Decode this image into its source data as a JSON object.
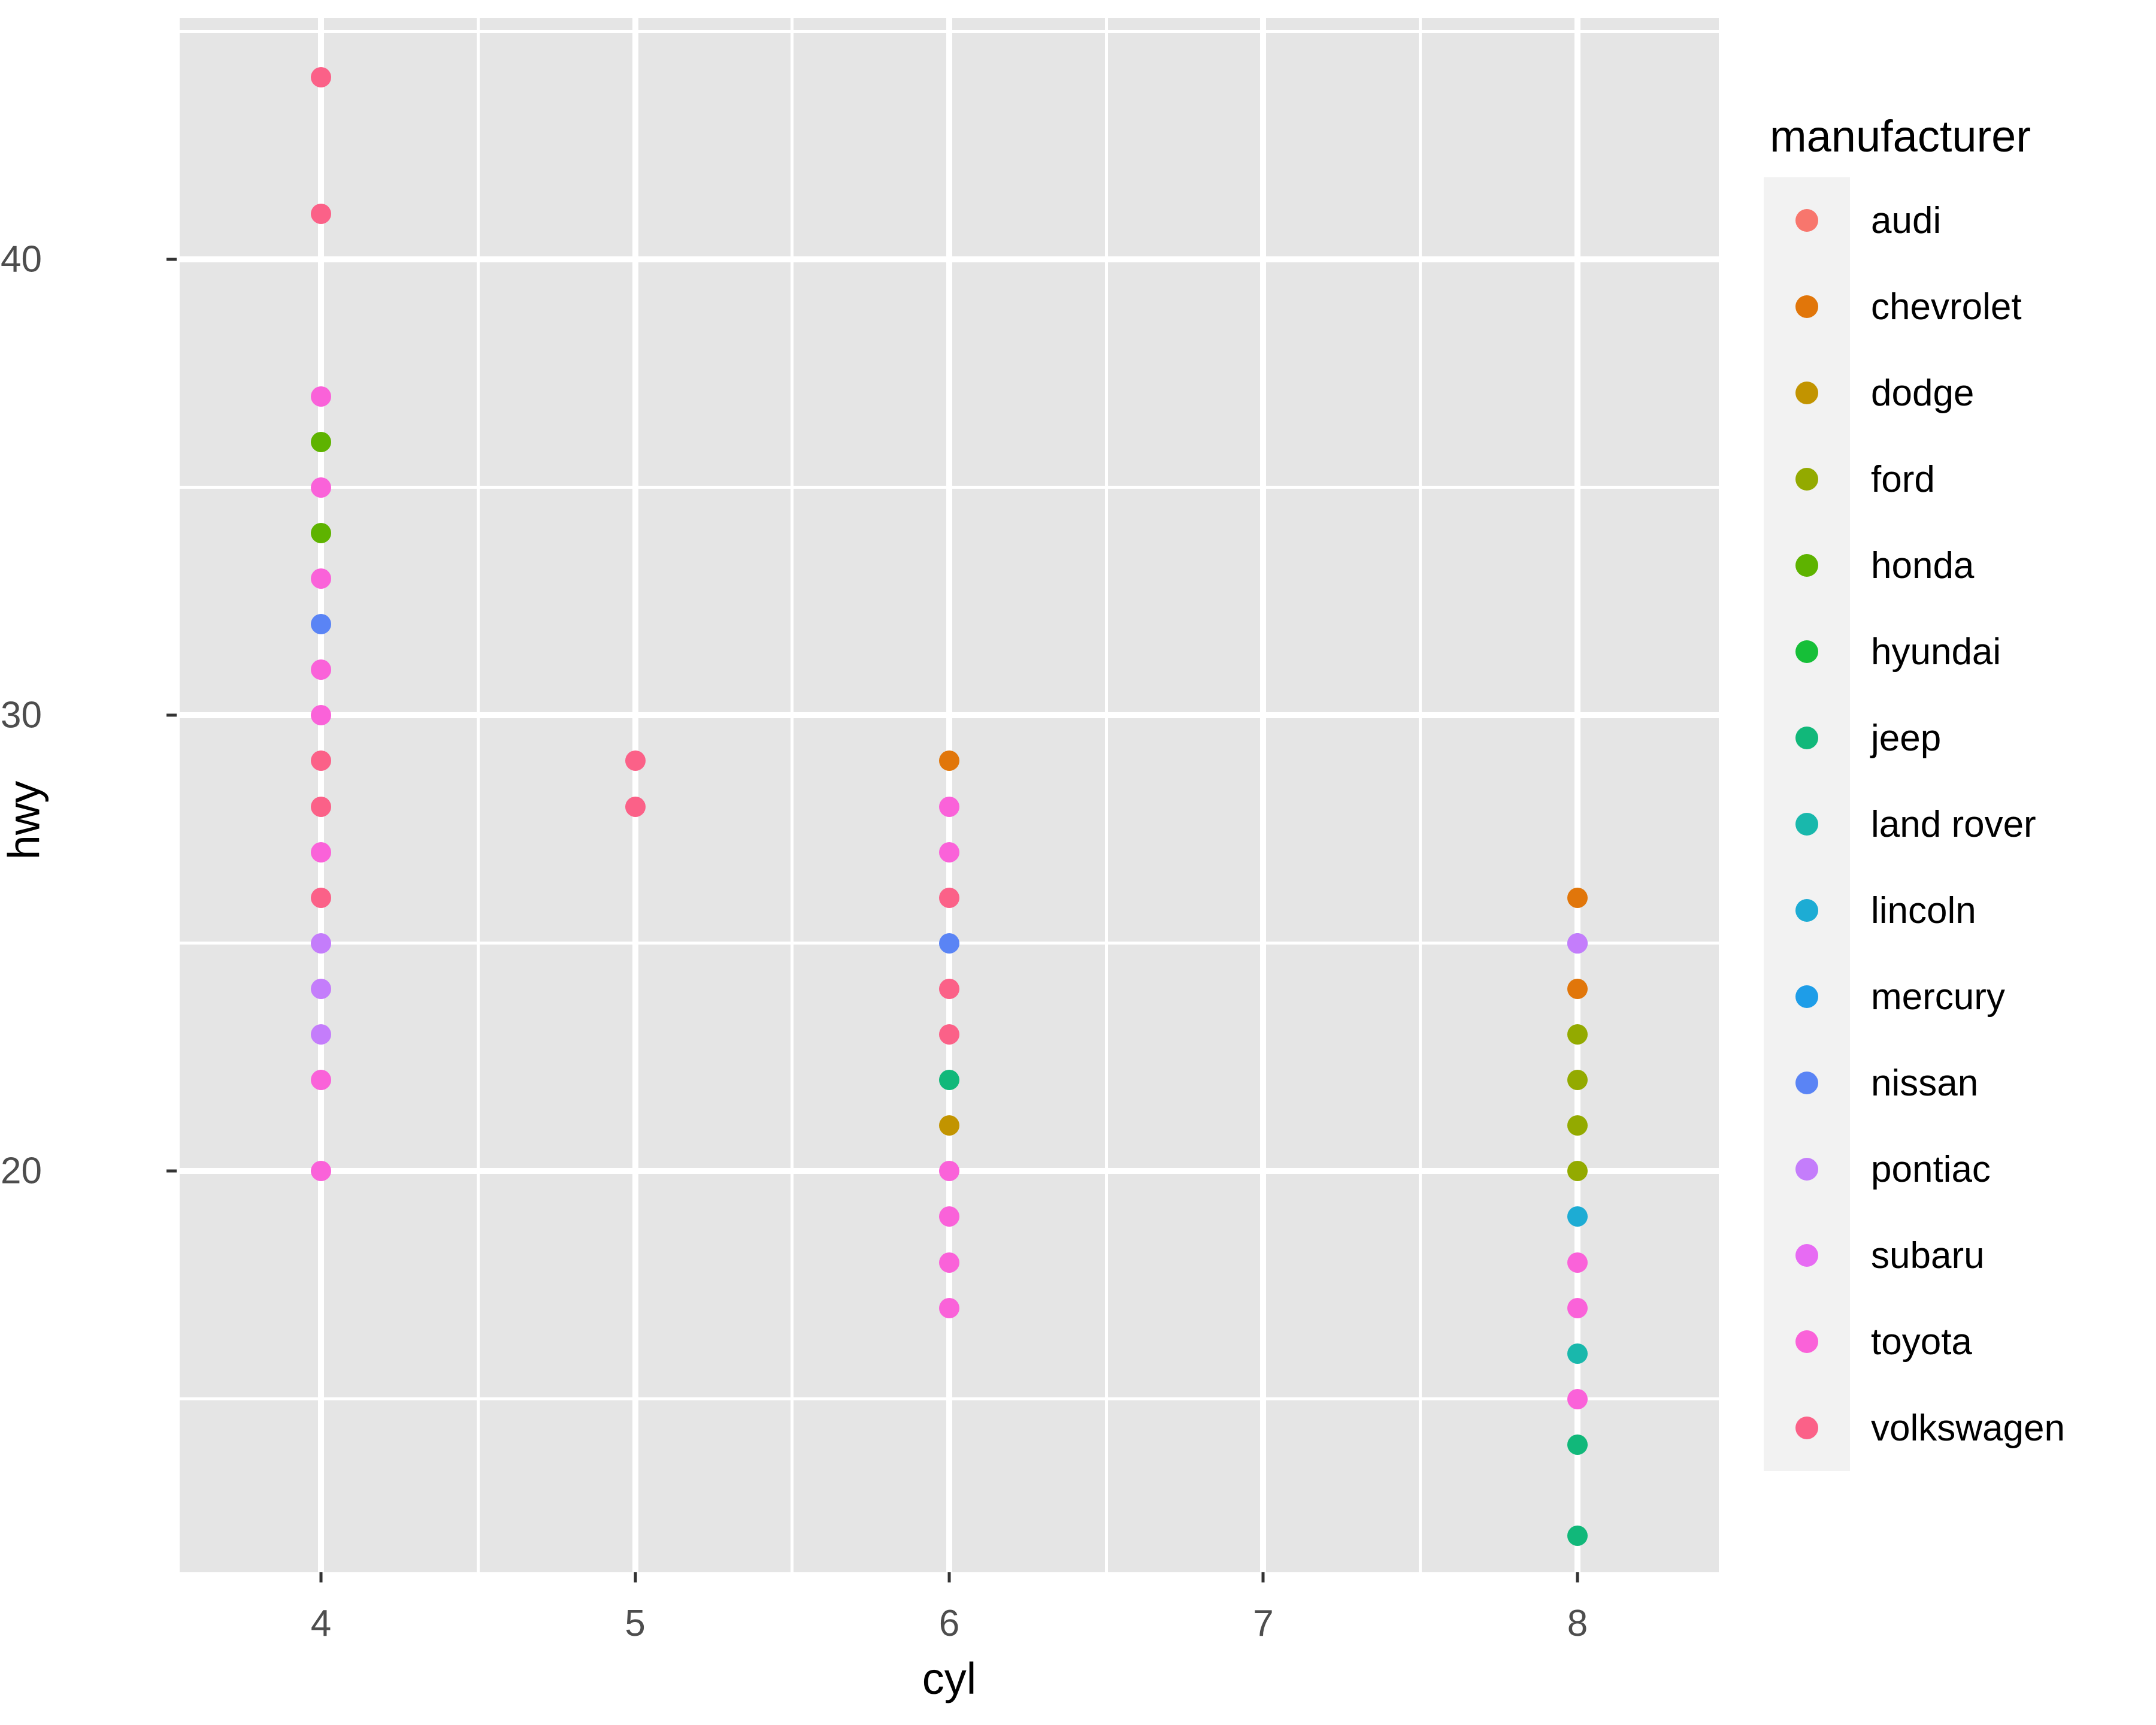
{
  "chart_data": {
    "type": "scatter",
    "title": "",
    "xlabel": "cyl",
    "ylabel": "hwy",
    "xlim": [
      3.55,
      8.45
    ],
    "ylim": [
      11.2,
      45.3
    ],
    "x_ticks": [
      "4",
      "5",
      "6",
      "7",
      "8"
    ],
    "x_tick_values": [
      4,
      5,
      6,
      7,
      8
    ],
    "y_ticks": [
      "20",
      "30",
      "40"
    ],
    "y_tick_values": [
      20,
      30,
      40
    ],
    "y_minor_values": [
      15,
      25,
      35,
      45
    ],
    "x_minor_values": [
      4.5,
      5.5,
      6.5,
      7.5
    ],
    "grid": true,
    "legend_position": "right",
    "legend_title": "manufacturer",
    "panel_background": "#e5e5e5",
    "grid_color": "#ffffff",
    "series": [
      {
        "name": "audi",
        "color": "#f8766d",
        "points": []
      },
      {
        "name": "chevrolet",
        "color": "#e1760a",
        "points": [
          {
            "x": 6,
            "y": 29
          },
          {
            "x": 8,
            "y": 26
          },
          {
            "x": 8,
            "y": 24
          }
        ]
      },
      {
        "name": "dodge",
        "color": "#c29400",
        "points": [
          {
            "x": 6,
            "y": 21
          }
        ]
      },
      {
        "name": "ford",
        "color": "#93aa00",
        "points": [
          {
            "x": 8,
            "y": 23
          },
          {
            "x": 8,
            "y": 22
          },
          {
            "x": 8,
            "y": 21
          },
          {
            "x": 8,
            "y": 20
          }
        ]
      },
      {
        "name": "honda",
        "color": "#5eb300",
        "points": [
          {
            "x": 4,
            "y": 36
          },
          {
            "x": 4,
            "y": 34
          }
        ]
      },
      {
        "name": "hyundai",
        "color": "#16bf38",
        "points": []
      },
      {
        "name": "jeep",
        "color": "#11b87a",
        "points": [
          {
            "x": 6,
            "y": 22
          },
          {
            "x": 8,
            "y": 14
          },
          {
            "x": 8,
            "y": 12
          }
        ]
      },
      {
        "name": "land rover",
        "color": "#19b8ac",
        "points": [
          {
            "x": 8,
            "y": 16
          }
        ]
      },
      {
        "name": "lincoln",
        "color": "#1dacd4",
        "points": [
          {
            "x": 8,
            "y": 19
          }
        ]
      },
      {
        "name": "mercury",
        "color": "#1e9de8",
        "points": []
      },
      {
        "name": "nissan",
        "color": "#5a84f5",
        "points": [
          {
            "x": 4,
            "y": 32
          },
          {
            "x": 6,
            "y": 25
          },
          {
            "x": 8,
            "y": 25
          }
        ]
      },
      {
        "name": "pontiac",
        "color": "#c47dfb",
        "points": [
          {
            "x": 4,
            "y": 25
          },
          {
            "x": 4,
            "y": 24
          },
          {
            "x": 4,
            "y": 23
          },
          {
            "x": 8,
            "y": 25
          }
        ]
      },
      {
        "name": "subaru",
        "color": "#e76bf3",
        "points": []
      },
      {
        "name": "toyota",
        "color": "#fa62d9",
        "points": [
          {
            "x": 4,
            "y": 37
          },
          {
            "x": 4,
            "y": 35
          },
          {
            "x": 4,
            "y": 33
          },
          {
            "x": 4,
            "y": 31
          },
          {
            "x": 4,
            "y": 30
          },
          {
            "x": 4,
            "y": 27
          },
          {
            "x": 4,
            "y": 22
          },
          {
            "x": 4,
            "y": 20
          },
          {
            "x": 6,
            "y": 28
          },
          {
            "x": 6,
            "y": 27
          },
          {
            "x": 6,
            "y": 20
          },
          {
            "x": 6,
            "y": 19
          },
          {
            "x": 6,
            "y": 18
          },
          {
            "x": 6,
            "y": 17
          },
          {
            "x": 8,
            "y": 18
          },
          {
            "x": 8,
            "y": 17
          },
          {
            "x": 8,
            "y": 15
          }
        ]
      },
      {
        "name": "volkswagen",
        "color": "#fb6188",
        "points": [
          {
            "x": 4,
            "y": 44
          },
          {
            "x": 4,
            "y": 41
          },
          {
            "x": 4,
            "y": 29
          },
          {
            "x": 4,
            "y": 28
          },
          {
            "x": 4,
            "y": 26
          },
          {
            "x": 5,
            "y": 29
          },
          {
            "x": 5,
            "y": 28
          },
          {
            "x": 6,
            "y": 26
          },
          {
            "x": 6,
            "y": 24
          },
          {
            "x": 6,
            "y": 23
          }
        ]
      }
    ]
  },
  "legend": {
    "title": "manufacturer",
    "items": [
      {
        "label": "audi",
        "color": "#f8766d"
      },
      {
        "label": "chevrolet",
        "color": "#e1760a"
      },
      {
        "label": "dodge",
        "color": "#c29400"
      },
      {
        "label": "ford",
        "color": "#93aa00"
      },
      {
        "label": "honda",
        "color": "#5eb300"
      },
      {
        "label": "hyundai",
        "color": "#16bf38"
      },
      {
        "label": "jeep",
        "color": "#11b87a"
      },
      {
        "label": "land rover",
        "color": "#19b8ac"
      },
      {
        "label": "lincoln",
        "color": "#1dacd4"
      },
      {
        "label": "mercury",
        "color": "#1e9de8"
      },
      {
        "label": "nissan",
        "color": "#5a84f5"
      },
      {
        "label": "pontiac",
        "color": "#c47dfb"
      },
      {
        "label": "subaru",
        "color": "#e76bf3"
      },
      {
        "label": "toyota",
        "color": "#fa62d9"
      },
      {
        "label": "volkswagen",
        "color": "#fb6188"
      }
    ]
  },
  "axes": {
    "x_title": "cyl",
    "y_title": "hwy",
    "x_tick_labels": [
      "4",
      "5",
      "6",
      "7",
      "8"
    ],
    "y_tick_labels": [
      "20",
      "30",
      "40"
    ]
  }
}
